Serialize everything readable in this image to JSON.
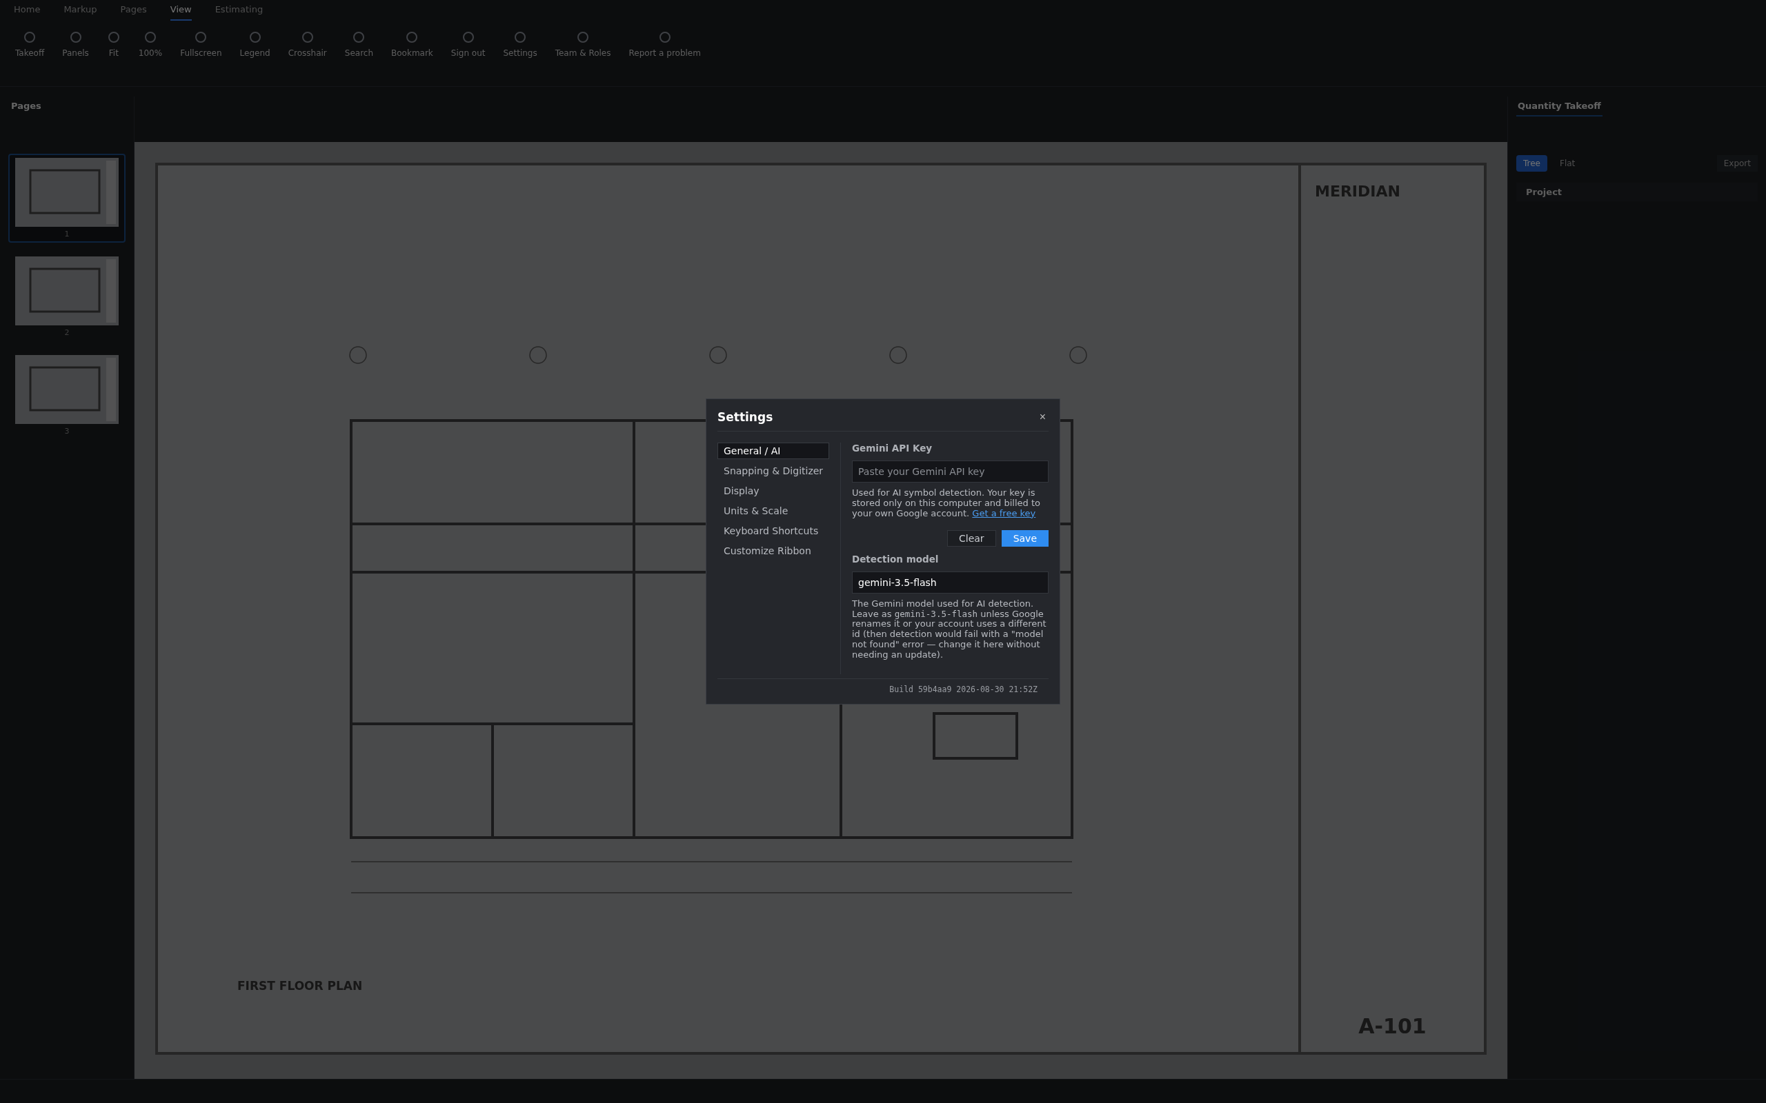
{
  "ribbon": {
    "tabs": [
      {
        "label": "Home",
        "selected": false
      },
      {
        "label": "Markup",
        "selected": false
      },
      {
        "label": "Pages",
        "selected": false
      },
      {
        "label": "View",
        "selected": true
      },
      {
        "label": "Estimating",
        "selected": false
      }
    ],
    "buttons": [
      {
        "label": "Takeoff"
      },
      {
        "label": "Panels"
      },
      {
        "label": "Fit"
      },
      {
        "label": "100%"
      },
      {
        "label": "Fullscreen"
      },
      {
        "label": "Legend"
      },
      {
        "label": "Crosshair"
      },
      {
        "label": "Search"
      },
      {
        "label": "Bookmark"
      },
      {
        "label": "Sign out"
      },
      {
        "label": "Settings"
      },
      {
        "label": "Team & Roles"
      },
      {
        "label": "Report a problem"
      }
    ]
  },
  "pages_panel": {
    "title": "Pages",
    "pages": [
      {
        "number": "1",
        "selected": true
      },
      {
        "number": "2",
        "selected": false
      },
      {
        "number": "3",
        "selected": false
      }
    ]
  },
  "sheet": {
    "firm": "MERIDIAN",
    "plan_title": "FIRST FLOOR PLAN",
    "sheet_number": "A-101"
  },
  "right_panel": {
    "tabs": [
      {
        "label": "Quantity Takeoff",
        "selected": true
      }
    ],
    "view_toggle": [
      {
        "label": "Tree",
        "selected": true
      },
      {
        "label": "Flat",
        "selected": false
      }
    ],
    "export": "Export",
    "group": "Project"
  },
  "settings": {
    "title": "Settings",
    "close": "×",
    "nav": [
      {
        "label": "General / AI",
        "selected": true
      },
      {
        "label": "Snapping & Digitizer",
        "selected": false
      },
      {
        "label": "Display",
        "selected": false
      },
      {
        "label": "Units & Scale",
        "selected": false
      },
      {
        "label": "Keyboard Shortcuts",
        "selected": false
      },
      {
        "label": "Customize Ribbon",
        "selected": false
      }
    ],
    "api_key": {
      "label": "Gemini API Key",
      "placeholder": "Paste your Gemini API key",
      "help": "Used for AI symbol detection. Your key is stored only on this computer and billed to your own Google account.",
      "link": "Get a free key"
    },
    "buttons": [
      {
        "label": "Clear",
        "kind": "secondary"
      },
      {
        "label": "Save",
        "kind": "primary"
      }
    ],
    "model": {
      "label": "Detection model",
      "value": "gemini-3.5-flash",
      "help_before": "The Gemini model used for AI detection. Leave as ",
      "help_code": "gemini-3.5-flash",
      "help_after": " unless Google renames it or your account uses a different id (then detection would fail with a \"model not found\" error — change it here without needing an update)."
    },
    "build": "Build 59b4aa9 2026-08-30 21:52Z"
  }
}
